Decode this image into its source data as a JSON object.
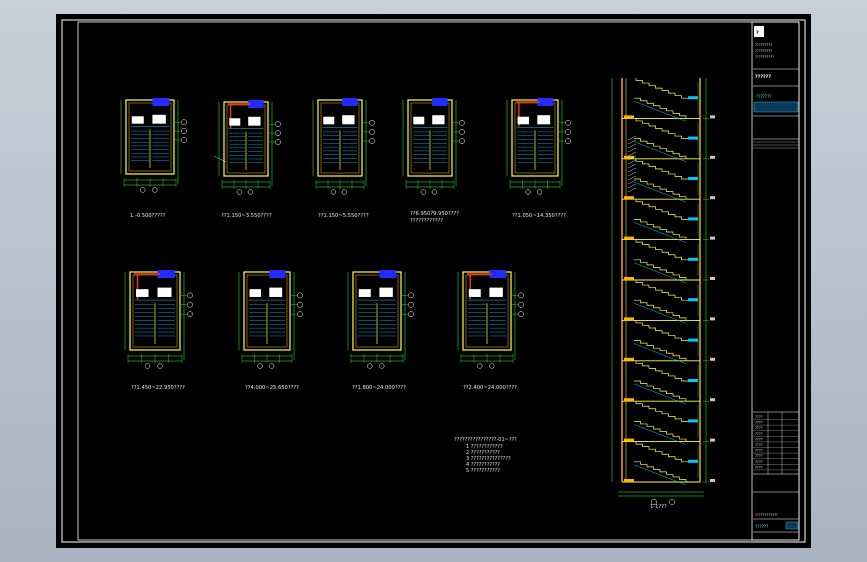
{
  "sheet": {
    "background": "#000000",
    "line_colors": {
      "frame": "#ffffff",
      "wall": "#ff3030",
      "stair": "#ffff40",
      "axis": "#30ff30",
      "dim": "#30ff30",
      "hatch": "#00c8ff",
      "text": "#e8e8e8",
      "infill": "#ffb400",
      "blue": "#1e2cff"
    }
  },
  "plans": {
    "row1": [
      {
        "label": "1.-0.500?????"
      },
      {
        "label": "??1.150~3.550????"
      },
      {
        "label": "??1.150~5.550????"
      },
      {
        "label": "??6.950?9.950????"
      },
      {
        "label": "??1.050~14.350????"
      }
    ],
    "row2": [
      {
        "label": "??1.450~22.950????"
      },
      {
        "label": "??4.000~25.650????"
      },
      {
        "label": "??1.800~24.000????"
      },
      {
        "label": "??2.400~24.000????"
      }
    ],
    "row1_sublabel": "????????????"
  },
  "notes": {
    "title": "????????????????-01~???",
    "items": [
      "1    ????????????",
      "2    ???????????",
      "3    ???????????????",
      "4    ???????????",
      "5    ???????????"
    ]
  },
  "section": {
    "label": "1-1???"
  },
  "title_block": {
    "company_lines": [
      "?????????",
      "?????????",
      "??????????"
    ],
    "logo": "?",
    "project_name": "??????",
    "stamp": "???????",
    "rows": [
      "????",
      "????",
      "????",
      "????",
      "????",
      "????",
      "????",
      "????",
      "????",
      "????"
    ],
    "bottom_lines": [
      "????????????",
      "??????"
    ]
  }
}
